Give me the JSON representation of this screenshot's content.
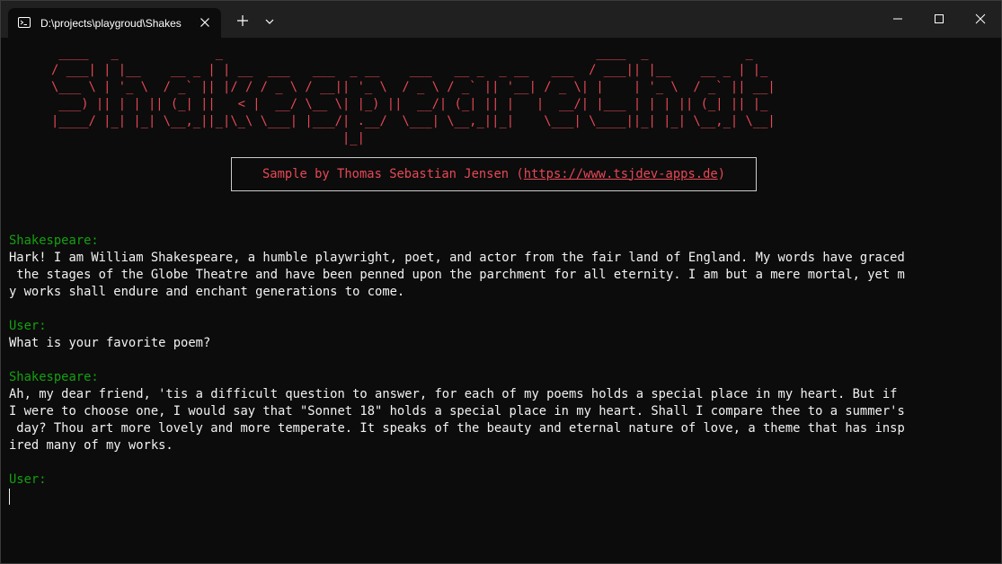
{
  "window": {
    "tab_title": "D:\\projects\\playgroud\\Shakes",
    "controls": {
      "new_tab": "+",
      "dropdown": "⌄"
    }
  },
  "banner": {
    "ascii_lines": [
      " ____   _             _                                                  ____  _             _   ",
      "/ ___| | |__    __ _ | | __  ___   ___  _ __    ___   __ _  _ __   ___  / ___|| |__    __ _ | |_ ",
      "\\___ \\ | '_ \\  / _` || |/ / / _ \\ / __|| '_ \\  / _ \\ / _` || '__| / _ \\| |    | '_ \\  / _` || __|",
      " ___) || | | || (_| ||   < |  __/ \\__ \\| |_) ||  __/| (_| || |   |  __/| |___ | | | || (_| || |_ ",
      "|____/ |_| |_| \\__,_||_|\\_\\ \\___| |___/| .__/  \\___| \\__,_||_|    \\___| \\____||_| |_| \\__,_| \\__|",
      "                                       |_|                                                         "
    ],
    "credit_prefix": "Sample by Thomas Sebastian Jensen (",
    "credit_link": "https://www.tsjdev-apps.de",
    "credit_suffix": ")"
  },
  "chat": {
    "messages": [
      {
        "speaker": "Shakespeare:",
        "lines": [
          "Hark! I am William Shakespeare, a humble playwright, poet, and actor from the fair land of England. My words have graced",
          " the stages of the Globe Theatre and have been penned upon the parchment for all eternity. I am but a mere mortal, yet m",
          "y works shall endure and enchant generations to come."
        ]
      },
      {
        "speaker": "User:",
        "lines": [
          "What is your favorite poem?"
        ]
      },
      {
        "speaker": "Shakespeare:",
        "lines": [
          "Ah, my dear friend, 'tis a difficult question to answer, for each of my poems holds a special place in my heart. But if",
          "I were to choose one, I would say that \"Sonnet 18\" holds a special place in my heart. Shall I compare thee to a summer's",
          " day? Thou art more lovely and more temperate. It speaks of the beauty and eternal nature of love, a theme that has insp",
          "ired many of my works."
        ]
      }
    ],
    "prompt": "User:"
  },
  "colors": {
    "background": "#0c0c0c",
    "titlebar": "#202020",
    "banner_red": "#e74856",
    "speaker_green": "#13a10e",
    "text": "#f2f2f2"
  }
}
